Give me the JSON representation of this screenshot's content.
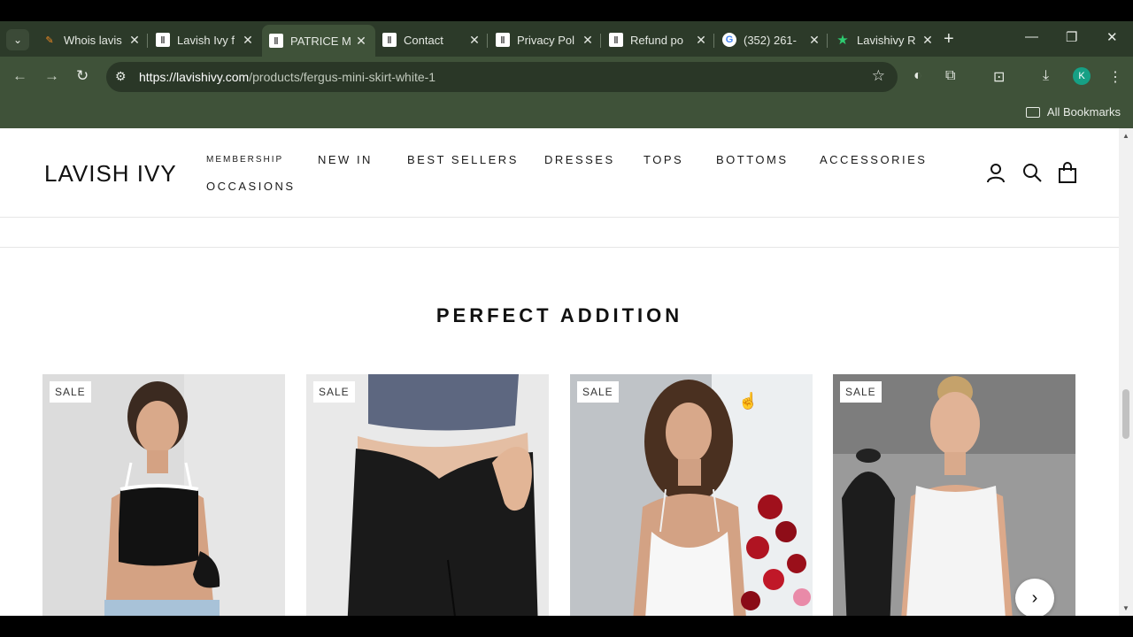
{
  "browser": {
    "tabs": [
      {
        "title": "Whois lavis",
        "favicon": "pen-favicon",
        "active": false
      },
      {
        "title": "Lavish Ivy f",
        "favicon": "li-favicon",
        "active": false
      },
      {
        "title": "PATRICE M",
        "favicon": "li-favicon",
        "active": true
      },
      {
        "title": "Contact",
        "favicon": "li-favicon",
        "active": false
      },
      {
        "title": "Privacy Pol",
        "favicon": "li-favicon",
        "active": false
      },
      {
        "title": "Refund po",
        "favicon": "li-favicon",
        "active": false
      },
      {
        "title": "(352) 261-",
        "favicon": "google-favicon",
        "active": false
      },
      {
        "title": "Lavishivy R",
        "favicon": "star-favicon",
        "active": false
      }
    ],
    "url_host": "https://lavishivy.com",
    "url_path": "/products/fergus-mini-skirt-white-1",
    "profile_initial": "K",
    "all_bookmarks": "All Bookmarks"
  },
  "site": {
    "logo": "LAVISH IVY",
    "nav": [
      "MEMBERSHIP",
      "NEW IN",
      "BEST SELLERS",
      "DRESSES",
      "TOPS",
      "BOTTOMS",
      "ACCESSORIES",
      "OCCASIONS"
    ],
    "section_title": "PERFECT ADDITION",
    "products": [
      {
        "badge": "SALE",
        "image": "model-black-crop-top"
      },
      {
        "badge": "SALE",
        "image": "model-black-pants"
      },
      {
        "badge": "SALE",
        "image": "model-white-dress-roses"
      },
      {
        "badge": "SALE",
        "image": "model-white-sleeveless-dress"
      }
    ]
  },
  "colors": {
    "chrome_bg": "#2c3a29",
    "toolbar_bg": "#3f5239",
    "accent_profile": "#16a085"
  }
}
